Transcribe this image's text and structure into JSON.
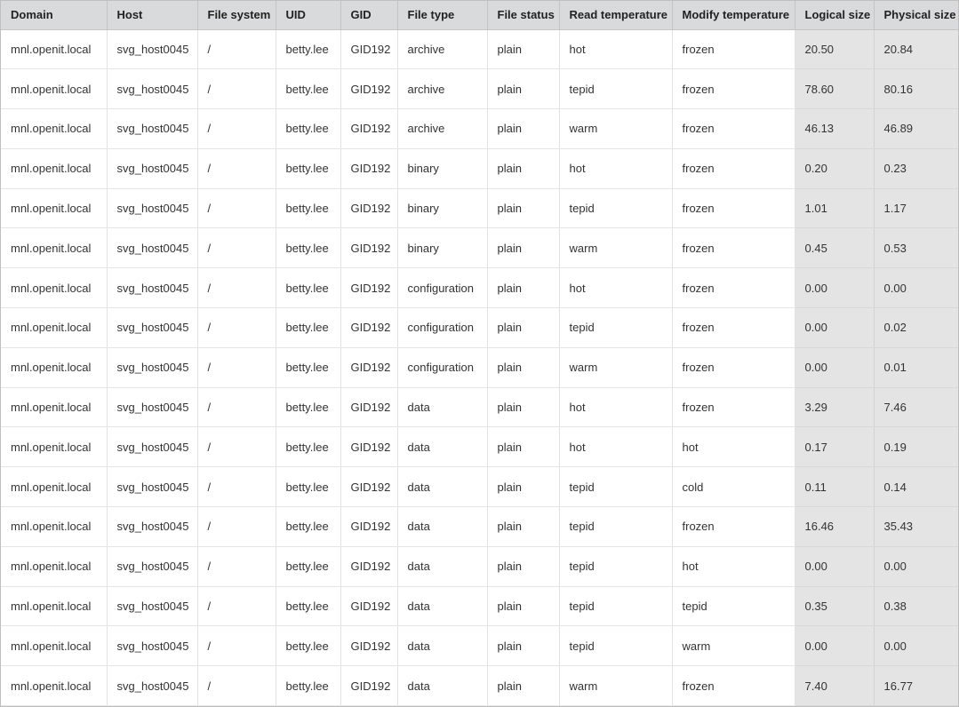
{
  "columns": [
    "Domain",
    "Host",
    "File system",
    "UID",
    "GID",
    "File type",
    "File status",
    "Read temperature",
    "Modify temperature",
    "Logical size",
    "Physical size"
  ],
  "rows": [
    [
      "mnl.openit.local",
      "svg_host0045",
      "/",
      "betty.lee",
      "GID192",
      "archive",
      "plain",
      "hot",
      "frozen",
      "20.50",
      "20.84"
    ],
    [
      "mnl.openit.local",
      "svg_host0045",
      "/",
      "betty.lee",
      "GID192",
      "archive",
      "plain",
      "tepid",
      "frozen",
      "78.60",
      "80.16"
    ],
    [
      "mnl.openit.local",
      "svg_host0045",
      "/",
      "betty.lee",
      "GID192",
      "archive",
      "plain",
      "warm",
      "frozen",
      "46.13",
      "46.89"
    ],
    [
      "mnl.openit.local",
      "svg_host0045",
      "/",
      "betty.lee",
      "GID192",
      "binary",
      "plain",
      "hot",
      "frozen",
      "0.20",
      "0.23"
    ],
    [
      "mnl.openit.local",
      "svg_host0045",
      "/",
      "betty.lee",
      "GID192",
      "binary",
      "plain",
      "tepid",
      "frozen",
      "1.01",
      "1.17"
    ],
    [
      "mnl.openit.local",
      "svg_host0045",
      "/",
      "betty.lee",
      "GID192",
      "binary",
      "plain",
      "warm",
      "frozen",
      "0.45",
      "0.53"
    ],
    [
      "mnl.openit.local",
      "svg_host0045",
      "/",
      "betty.lee",
      "GID192",
      "configuration",
      "plain",
      "hot",
      "frozen",
      "0.00",
      "0.00"
    ],
    [
      "mnl.openit.local",
      "svg_host0045",
      "/",
      "betty.lee",
      "GID192",
      "configuration",
      "plain",
      "tepid",
      "frozen",
      "0.00",
      "0.02"
    ],
    [
      "mnl.openit.local",
      "svg_host0045",
      "/",
      "betty.lee",
      "GID192",
      "configuration",
      "plain",
      "warm",
      "frozen",
      "0.00",
      "0.01"
    ],
    [
      "mnl.openit.local",
      "svg_host0045",
      "/",
      "betty.lee",
      "GID192",
      "data",
      "plain",
      "hot",
      "frozen",
      "3.29",
      "7.46"
    ],
    [
      "mnl.openit.local",
      "svg_host0045",
      "/",
      "betty.lee",
      "GID192",
      "data",
      "plain",
      "hot",
      "hot",
      "0.17",
      "0.19"
    ],
    [
      "mnl.openit.local",
      "svg_host0045",
      "/",
      "betty.lee",
      "GID192",
      "data",
      "plain",
      "tepid",
      "cold",
      "0.11",
      "0.14"
    ],
    [
      "mnl.openit.local",
      "svg_host0045",
      "/",
      "betty.lee",
      "GID192",
      "data",
      "plain",
      "tepid",
      "frozen",
      "16.46",
      "35.43"
    ],
    [
      "mnl.openit.local",
      "svg_host0045",
      "/",
      "betty.lee",
      "GID192",
      "data",
      "plain",
      "tepid",
      "hot",
      "0.00",
      "0.00"
    ],
    [
      "mnl.openit.local",
      "svg_host0045",
      "/",
      "betty.lee",
      "GID192",
      "data",
      "plain",
      "tepid",
      "tepid",
      "0.35",
      "0.38"
    ],
    [
      "mnl.openit.local",
      "svg_host0045",
      "/",
      "betty.lee",
      "GID192",
      "data",
      "plain",
      "tepid",
      "warm",
      "0.00",
      "0.00"
    ],
    [
      "mnl.openit.local",
      "svg_host0045",
      "/",
      "betty.lee",
      "GID192",
      "data",
      "plain",
      "warm",
      "frozen",
      "7.40",
      "16.77"
    ]
  ],
  "colors": {
    "header_background": "#d9dadb",
    "numeric_column_background": "#e4e4e4",
    "text": "#333333"
  }
}
